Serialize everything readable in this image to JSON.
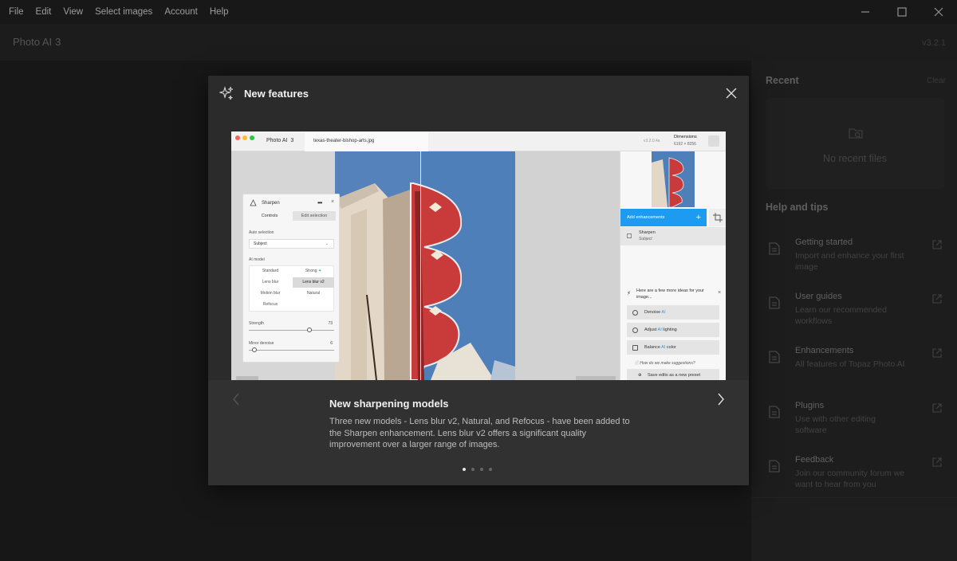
{
  "menu": [
    "File",
    "Edit",
    "View",
    "Select images",
    "Account",
    "Help"
  ],
  "app": {
    "name": "Photo AI",
    "major": "3",
    "version": "v3.2.1"
  },
  "right_panel": {
    "recent_heading": "Recent",
    "clear_label": "Clear",
    "no_recent": "No recent files",
    "help_heading": "Help and tips",
    "tips": [
      {
        "title": "Getting started",
        "desc": "Import and enhance your first image"
      },
      {
        "title": "User guides",
        "desc": "Learn our recommended workflows"
      },
      {
        "title": "Enhancements",
        "desc": "All features of Topaz Photo AI"
      },
      {
        "title": "Plugins",
        "desc": "Use with other editing software"
      },
      {
        "title": "Feedback",
        "desc": "Join our community forum we want to hear from you"
      }
    ]
  },
  "modal": {
    "title": "New features",
    "slide": {
      "title": "New sharpening models",
      "description": "Three new models - Lens blur v2, Natural, and Refocus - have been added to the Sharpen enhancement. Lens blur v2 offers a significant quality improvement over a larger range of images."
    },
    "dots_total": 4,
    "dots_active": 1
  },
  "preview": {
    "app_name": "Photo AI",
    "app_major": "3",
    "file_name": "texas-theater-bishop-arts.jpg",
    "version": "v3.2.0.4a",
    "dimensions_label": "Dimensions",
    "dimensions_value": "6192 × 8256",
    "sharpen": {
      "title": "Sharpen",
      "tab_controls": "Controls",
      "tab_edit": "Edit selection",
      "auto_selection_label": "Auto selection",
      "auto_selection_value": "Subject",
      "ai_model_label": "AI model",
      "models": [
        "Standard",
        "Strong",
        "Lens blur",
        "Lens blur v2",
        "Motion blur",
        "Natural",
        "Refocus"
      ],
      "selected_model": "Lens blur v2",
      "strength_label": "Strength",
      "strength_value": "73",
      "minor_denoise_label": "Minor denoise",
      "minor_denoise_value": "6"
    },
    "right": {
      "add_enhancements": "Add enhancements",
      "enh_name": "Sharpen",
      "enh_sub": "Subject",
      "ideas_title": "Here are a few more ideas for your image...",
      "idea1_pre": "Denoise",
      "idea1_ai": "AI",
      "idea2_pre": "Adjust",
      "idea2_ai": "AI",
      "idea2_post": "lighting",
      "idea3_pre": "Balance",
      "idea3_ai": "AI",
      "idea3_post": "color",
      "how": "How do we make suggestions?",
      "save_preset": "Save edits as a new preset"
    }
  }
}
